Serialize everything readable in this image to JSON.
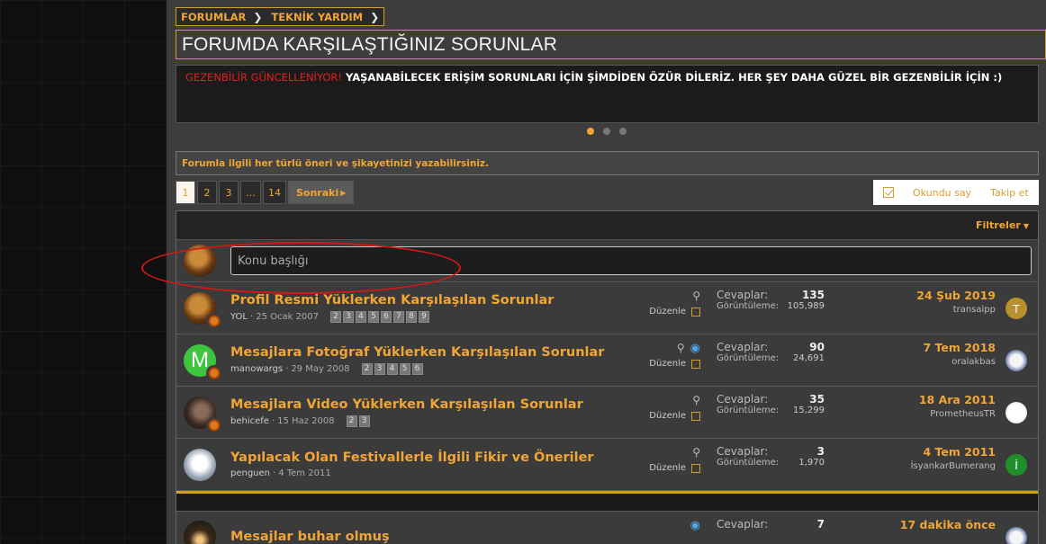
{
  "breadcrumb": [
    "FORUMLAR",
    "TEKNİK YARDIM"
  ],
  "page_title": "FORUMDA KARŞILAŞTIĞINIZ SORUNLAR",
  "notice": {
    "highlight": "GEZENBİLİR GÜNCELLENİYOR!",
    "text": " YAŞANABİLECEK ERİŞİM SORUNLARI İÇİN ŞİMDİDEN ÖZÜR DİLERİZ. HER ŞEY DAHA GÜZEL BİR GEZENBİLİR İÇİN :)"
  },
  "info_text": "Forumla ilgili her türlü öneri ve şikayetinizi yazabilirsiniz.",
  "pagination": {
    "pages": [
      "1",
      "2",
      "3",
      "…",
      "14"
    ],
    "next": "Sonraki"
  },
  "actions": {
    "mark_read": "Okundu say",
    "follow": "Takip et"
  },
  "filter_label": "Filtreler",
  "new_thread": {
    "placeholder": "Konu başlığı"
  },
  "labels": {
    "replies": "Cevaplar:",
    "views": "Görüntüleme:",
    "edit": "Düzenle"
  },
  "threads": [
    {
      "title": "Profil Resmi Yüklerken Karşılaşılan Sorunlar",
      "author": "YOL",
      "date": "25 Ocak 2007",
      "pages": [
        "2",
        "3",
        "4",
        "5",
        "6",
        "7",
        "8",
        "9"
      ],
      "replies": "135",
      "views": "105,989",
      "last_date": "24 Şub 2019",
      "last_user": "transalpp",
      "last_avatar_letter": "T",
      "avatar_letter": "",
      "watching": false
    },
    {
      "title": "Mesajlara Fotoğraf Yüklerken Karşılaşılan Sorunlar",
      "author": "manowargs",
      "date": "29 May 2008",
      "pages": [
        "2",
        "3",
        "4",
        "5",
        "6"
      ],
      "replies": "90",
      "views": "24,691",
      "last_date": "7 Tem 2018",
      "last_user": "oralakbas",
      "last_avatar_letter": "",
      "avatar_letter": "M",
      "watching": true
    },
    {
      "title": "Mesajlara Video Yüklerken Karşılaşılan Sorunlar",
      "author": "behicefe",
      "date": "15 Haz 2008",
      "pages": [
        "2",
        "3"
      ],
      "replies": "35",
      "views": "15,299",
      "last_date": "18 Ara 2011",
      "last_user": "PrometheusTR",
      "last_avatar_letter": "",
      "avatar_letter": "",
      "watching": false
    },
    {
      "title": "Yapılacak Olan Festivallerle İlgili Fikir ve Öneriler",
      "author": "penguen",
      "date": "4 Tem 2011",
      "pages": [],
      "replies": "3",
      "views": "1,970",
      "last_date": "4 Tem 2011",
      "last_user": "İsyankarBumerang",
      "last_avatar_letter": "İ",
      "avatar_letter": "",
      "watching": false
    }
  ],
  "next_thread": {
    "title": "Mesajlar buhar olmuş",
    "replies": "7",
    "last_date": "17 dakika önce"
  },
  "colors": {
    "accent": "#f0a535",
    "border_gold": "#d39e2e",
    "notice_red": "#e02020",
    "watch_blue": "#4ea6e8"
  }
}
